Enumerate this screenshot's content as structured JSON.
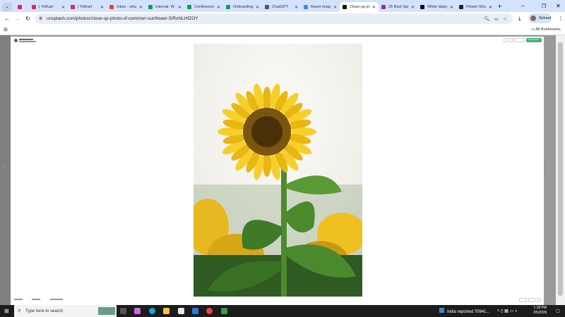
{
  "tabs": [
    {
      "title": "",
      "icon": "yolkart-icon",
      "color": "#e0245e"
    },
    {
      "title": "| YolKart",
      "icon": "yolkart-icon",
      "color": "#e0245e"
    },
    {
      "title": "| YolKart",
      "icon": "yolkart-icon",
      "color": "#e0245e"
    },
    {
      "title": "Inbox - ishu",
      "icon": "gmail-icon",
      "color": "#ea4335"
    },
    {
      "title": "Internal- W",
      "icon": "sheets-icon",
      "color": "#0f9d58"
    },
    {
      "title": "Conference",
      "icon": "sheets-icon",
      "color": "#0f9d58"
    },
    {
      "title": "Onboarding",
      "icon": "sheets-icon",
      "color": "#0f9d58"
    },
    {
      "title": "ChatGPT",
      "icon": "chatgpt-icon",
      "color": "#555555"
    },
    {
      "title": "flower imag",
      "icon": "google-icon",
      "color": "#4285f4"
    },
    {
      "title": "Close-up pl",
      "icon": "unsplash-icon",
      "color": "#111111",
      "active": true
    },
    {
      "title": "25 Best Spr",
      "icon": "site-icon",
      "color": "#a0307a"
    },
    {
      "title": "White daisy",
      "icon": "unsplash-icon",
      "color": "#111111"
    },
    {
      "title": "Flower Sho",
      "icon": "site-icon",
      "color": "#222222"
    }
  ],
  "toolbar": {
    "url": "unsplash.com/photos/close-up-photo-of-common-sunflower-5IRxNLHfZOY",
    "profile": "School"
  },
  "bookmarks": {
    "all": "All Bookmarks"
  },
  "modal": {
    "download": "Download free",
    "accent": "#3cb46e"
  },
  "taskbar": {
    "search_placeholder": "Type here to search",
    "news": "India reported 70941...",
    "time": "1:18 PM",
    "date": "2/5/2026"
  }
}
